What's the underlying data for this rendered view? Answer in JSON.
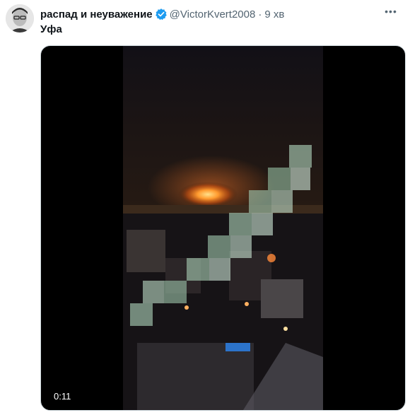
{
  "tweet": {
    "display_name": "распад и неуважение",
    "handle": "@VictorKvert2008",
    "separator": "·",
    "time": "9 хв",
    "text": "Уфа",
    "verified_icon": "verified-badge-icon",
    "more_icon": "more-dots-icon",
    "verified_color": "#1d9bf0"
  },
  "video": {
    "duration": "0:11"
  }
}
